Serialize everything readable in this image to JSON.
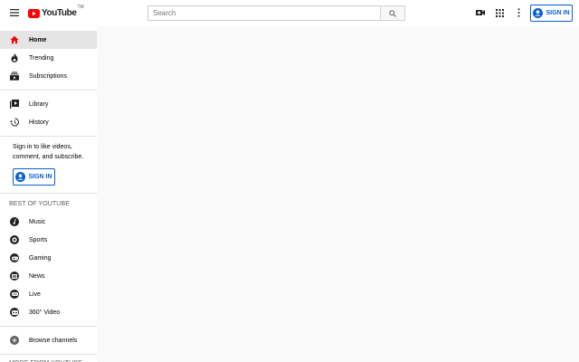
{
  "header": {
    "logo_text": "YouTube",
    "logo_tm": "TM",
    "search_placeholder": "Search",
    "signin_label": "SIGN IN",
    "icons": [
      "menu-icon",
      "youtube-logo-icon",
      "search-icon",
      "create-video-icon",
      "apps-grid-icon",
      "more-vert-icon",
      "account-icon"
    ]
  },
  "sidebar": {
    "primary": [
      {
        "label": "Home",
        "icon": "home-icon",
        "active": true
      },
      {
        "label": "Trending",
        "icon": "flame-icon",
        "active": false
      },
      {
        "label": "Subscriptions",
        "icon": "subscriptions-icon",
        "active": false
      }
    ],
    "secondary": [
      {
        "label": "Library",
        "icon": "library-icon"
      },
      {
        "label": "History",
        "icon": "history-icon"
      }
    ],
    "signin_prompt": "Sign in to like videos, comment, and subscribe.",
    "signin_label": "SIGN IN",
    "best_of_title": "BEST OF YOUTUBE",
    "best_of": [
      {
        "label": "Music",
        "icon": "music-icon"
      },
      {
        "label": "Sports",
        "icon": "sports-icon"
      },
      {
        "label": "Gaming",
        "icon": "gaming-icon"
      },
      {
        "label": "News",
        "icon": "news-icon"
      },
      {
        "label": "Live",
        "icon": "live-icon"
      },
      {
        "label": "360° Video",
        "icon": "360-video-icon"
      }
    ],
    "browse_channels": {
      "label": "Browse channels",
      "icon": "add-circle-icon"
    },
    "more_from_title": "MORE FROM YOUTUBE"
  },
  "colors": {
    "brand_red": "#ff0000",
    "accent_blue": "#065fd4",
    "active_bg": "#e5e5e5",
    "page_bg": "#f9f9f9"
  }
}
